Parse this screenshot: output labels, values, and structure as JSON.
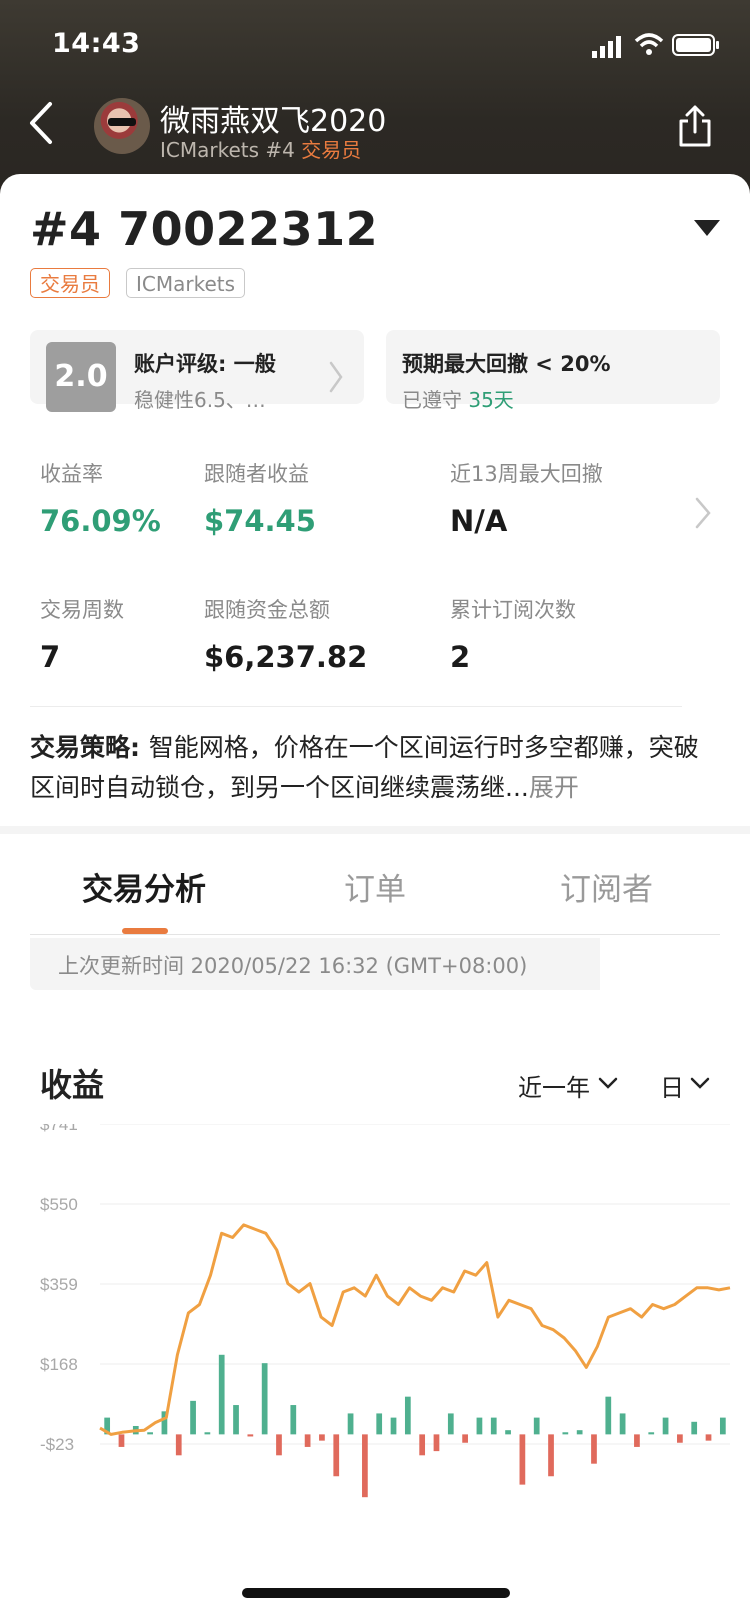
{
  "status_bar": {
    "time": "14:43"
  },
  "header": {
    "trader_name": "微雨燕双飞2020",
    "broker_prefix": "ICMarkets #4 ",
    "role": "交易员",
    "icons": [
      "chevron-left-icon",
      "avatar",
      "share-icon"
    ]
  },
  "account": {
    "title": "#4 70022312",
    "tags": [
      "交易员",
      "ICMarkets"
    ],
    "rating_box": {
      "score": "2.0",
      "title": "账户评级: 一般",
      "subtitle": "稳健性6.5、…"
    },
    "drawdown_box": {
      "title": "预期最大回撤 < 20%",
      "prefix": "已遵守 ",
      "days": "35天"
    }
  },
  "stats": [
    {
      "label": "收益率",
      "value": "76.09%",
      "green": true
    },
    {
      "label": "跟随者收益",
      "value": "$74.45",
      "green": true
    },
    {
      "label": "近13周最大回撤",
      "value": "N/A",
      "green": false
    },
    {
      "label": "交易周数",
      "value": "7",
      "green": false
    },
    {
      "label": "跟随资金总额",
      "value": "$6,237.82",
      "green": false
    },
    {
      "label": "累计订阅次数",
      "value": "2",
      "green": false
    }
  ],
  "strategy": {
    "label": "交易策略: ",
    "text": "智能网格，价格在一个区间运行时多空都赚，突破区间时自动锁仓，到另一个区间继续震荡继",
    "ellipsis": "...",
    "expand": "展开"
  },
  "tabs": [
    {
      "label": "交易分析",
      "active": true
    },
    {
      "label": "订单",
      "active": false
    },
    {
      "label": "订阅者",
      "active": false
    }
  ],
  "last_update": "上次更新时间 2020/05/22 16:32 (GMT+08:00)",
  "section": {
    "title": "收益",
    "range": "近一年",
    "granularity": "日"
  },
  "colors": {
    "accent": "#e97b3f",
    "green": "#2f9e76",
    "line": "#f0a042",
    "bar_pos": "#4fb08f",
    "bar_neg": "#e06a5c"
  },
  "chart_data": {
    "type": "line",
    "title": "",
    "ylabel": "",
    "ylim": [
      -23,
      741
    ],
    "y_ticks": [
      "$741",
      "$550",
      "$359",
      "$168",
      "-$23"
    ],
    "y_tick_values": [
      741,
      550,
      359,
      168,
      -23
    ],
    "series": [
      {
        "values": [
          15,
          0,
          5,
          8,
          10,
          28,
          40,
          190,
          290,
          310,
          380,
          480,
          470,
          500,
          490,
          480,
          440,
          360,
          340,
          360,
          280,
          260,
          340,
          350,
          330,
          380,
          330,
          310,
          350,
          330,
          320,
          350,
          340,
          390,
          380,
          410,
          280,
          320,
          310,
          300,
          260,
          250,
          230,
          200,
          160,
          210,
          280,
          290,
          300,
          280,
          310,
          300,
          310,
          330,
          350,
          350,
          345,
          350
        ]
      },
      {
        "values": [
          40,
          -30,
          20,
          5,
          55,
          -50,
          80,
          5,
          190,
          70,
          -5,
          170,
          -50,
          70,
          -30,
          -15,
          -100,
          50,
          -150,
          50,
          40,
          90,
          -50,
          -40,
          50,
          -20,
          40,
          40,
          10,
          -120,
          40,
          -100,
          5,
          10,
          -70,
          90,
          50,
          -30,
          5,
          40,
          -20,
          30,
          -15,
          40
        ]
      }
    ]
  }
}
